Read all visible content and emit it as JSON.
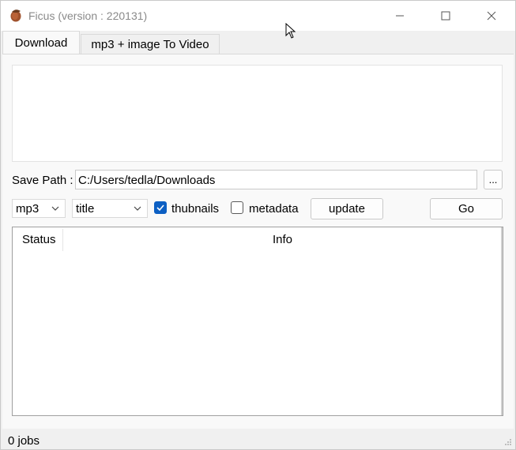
{
  "window": {
    "title": "Ficus (version : 220131)",
    "icon": "acorn-icon",
    "controls": [
      "minimize-icon",
      "maximize-icon",
      "close-icon"
    ]
  },
  "tabs": [
    {
      "label": "Download",
      "active": true
    },
    {
      "label": "mp3 + image To Video",
      "active": false
    }
  ],
  "download": {
    "url_text": "",
    "save_path_label": "Save Path :",
    "save_path_value": "C:/Users/tedla/Downloads",
    "browse_label": "...",
    "format_selected": "mp3",
    "naming_selected": "title",
    "thumbnails_label": "thubnails",
    "thumbnails_checked": true,
    "metadata_label": "metadata",
    "metadata_checked": false,
    "update_label": "update",
    "go_label": "Go"
  },
  "jobs_table": {
    "columns": [
      "Status",
      "Info"
    ],
    "rows": []
  },
  "statusbar": {
    "text": "0 jobs"
  },
  "colors": {
    "accent": "#0c5fc3",
    "background": "#f0f0f0"
  }
}
